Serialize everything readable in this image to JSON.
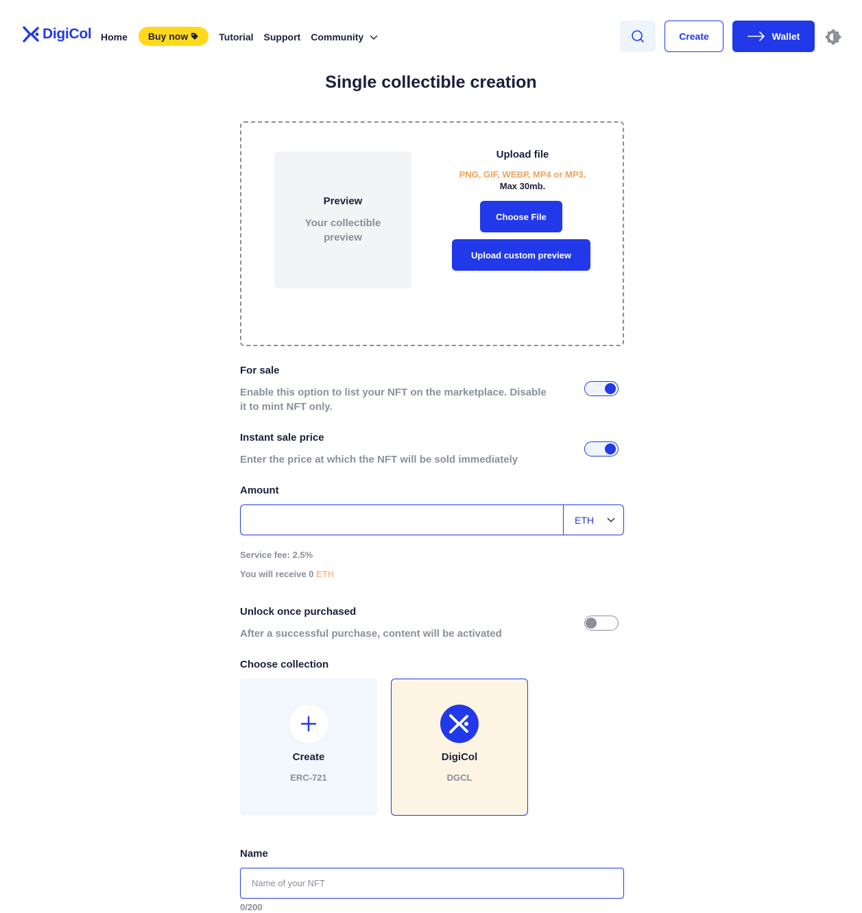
{
  "brand": {
    "name": "DigiCol",
    "accent": "#2139e8"
  },
  "nav": {
    "home": "Home",
    "buy_now": "Buy now",
    "tutorial": "Tutorial",
    "support": "Support",
    "community": "Community"
  },
  "header_actions": {
    "search_icon": "search-icon",
    "create": "Create",
    "wallet": "Wallet",
    "theme_icon": "theme-toggle-icon"
  },
  "page_title": "Single collectible creation",
  "upload": {
    "preview_title": "Preview",
    "preview_subtitle": "Your collectible preview",
    "title": "Upload file",
    "formats": "PNG, GIF, WEBP, MP4 or MP3.",
    "max_size": "Max 30mb.",
    "choose_file": "Choose File",
    "upload_custom_preview": "Upload custom preview"
  },
  "for_sale": {
    "label": "For sale",
    "description": "Enable this option to list your NFT on the marketplace. Disable it to mint NFT only.",
    "enabled": true
  },
  "instant_sale": {
    "label": "Instant sale price",
    "description": "Enter the price at which the NFT will be sold immediately",
    "enabled": true
  },
  "amount": {
    "label": "Amount",
    "value": "",
    "currency": "ETH"
  },
  "fees": {
    "service_fee": "Service fee: 2.5%",
    "receive_prefix": "You will receive 0",
    "receive_currency": "ETH"
  },
  "unlock": {
    "label": "Unlock once purchased",
    "description": "After a successful purchase, content will be activated",
    "enabled": false
  },
  "collection": {
    "label": "Choose collection",
    "cards": [
      {
        "name": "Create",
        "subtitle": "ERC-721",
        "icon": "plus-icon"
      },
      {
        "name": "DigiCol",
        "subtitle": "DGCL",
        "icon": "digicol-logo-icon",
        "selected": true
      }
    ]
  },
  "name_field": {
    "label": "Name",
    "placeholder": "Name of your NFT",
    "value": "",
    "counter": "0/200"
  }
}
